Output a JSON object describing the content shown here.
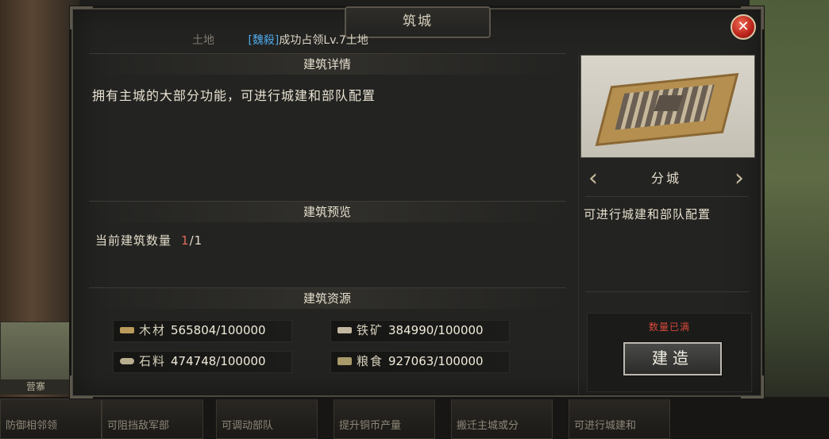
{
  "dialog": {
    "title": "筑城",
    "close_icon": "✕"
  },
  "notice": {
    "dim_text": "土地",
    "alliance_tag": "[魏殺]",
    "message": "成功占领Lv.7土地"
  },
  "details": {
    "header": "建筑详情",
    "description": "拥有主城的大部分功能，可进行城建和部队配置"
  },
  "preview": {
    "header": "建筑预览",
    "count_label": "当前建筑数量",
    "count_current": "1",
    "count_total": "/1"
  },
  "resources": {
    "header": "建筑资源",
    "items": [
      {
        "name": "木材",
        "value": "565804/100000",
        "icon": "wood-icon"
      },
      {
        "name": "铁矿",
        "value": "384990/100000",
        "icon": "iron-icon"
      },
      {
        "name": "石料",
        "value": "474748/100000",
        "icon": "stone-icon"
      },
      {
        "name": "粮食",
        "value": "927063/100000",
        "icon": "grain-icon"
      }
    ]
  },
  "building": {
    "name": "分城",
    "description": "可进行城建和部队配置",
    "status": "数量已满",
    "build_label": "建造",
    "prev_icon": "‹",
    "next_icon": "›"
  },
  "background": {
    "thumb_label": "营寨",
    "cards": [
      "防御相邻领",
      "可阻挡敌军部",
      "可调动部队",
      "提升铜币产量",
      "搬迁主城或分",
      "可进行城建和"
    ]
  }
}
